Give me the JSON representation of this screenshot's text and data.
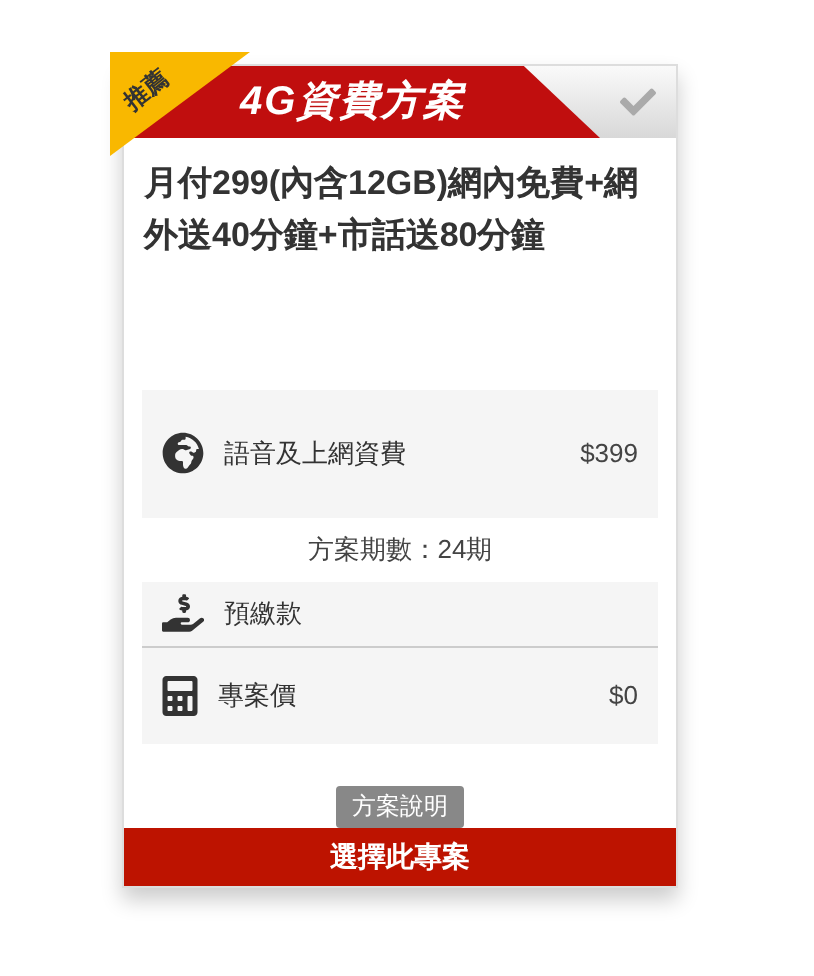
{
  "ribbon": "推薦",
  "header": {
    "title": "4G資費方案",
    "selected": false
  },
  "plan_title": "月付299(內含12GB)網內免費+網外送40分鐘+市話送80分鐘",
  "rows": [
    {
      "kind": "globe",
      "label": "語音及上網資費",
      "value": "$399"
    },
    {
      "kind": "period",
      "label": "方案期數：24期"
    },
    {
      "kind": "hand",
      "label": "預繳款"
    },
    {
      "kind": "calculator",
      "label": "專案價",
      "value": "$0"
    }
  ],
  "details_button": "方案說明",
  "select_button": "選擇此專案"
}
